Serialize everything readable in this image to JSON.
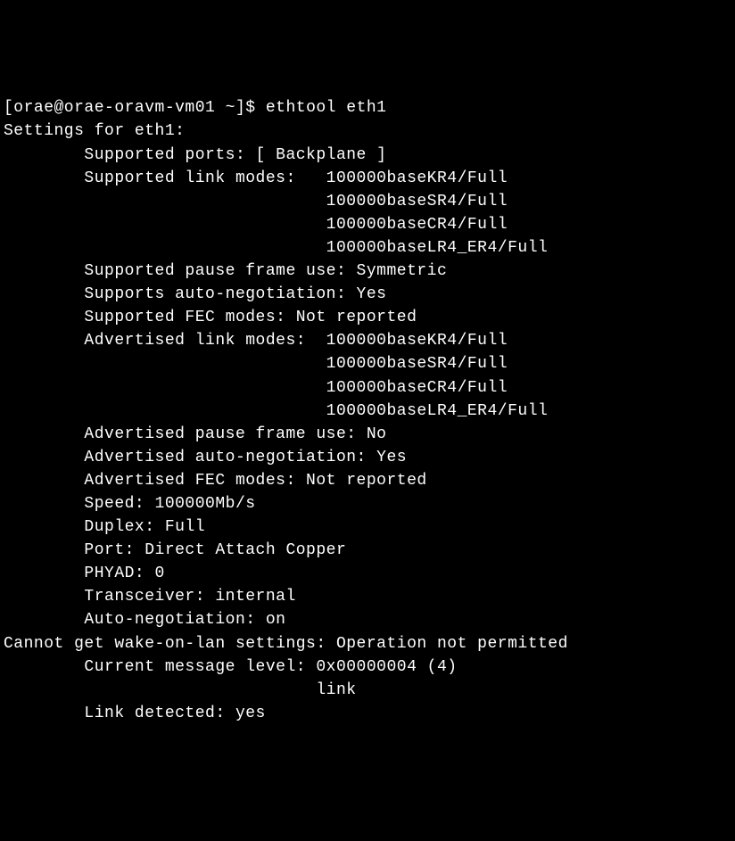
{
  "prompt": "[orae@orae-oravm-vm01 ~]$ ",
  "command": "ethtool eth1",
  "output": {
    "header": "Settings for eth1:",
    "supported_ports_label": "        Supported ports: [ Backplane ]",
    "supported_link_modes_label": "        Supported link modes:   ",
    "supported_link_modes": [
      "100000baseKR4/Full",
      "100000baseSR4/Full",
      "100000baseCR4/Full",
      "100000baseLR4_ER4/Full"
    ],
    "supported_link_modes_indent": "                                ",
    "supported_pause_frame": "        Supported pause frame use: Symmetric",
    "supports_auto_neg": "        Supports auto-negotiation: Yes",
    "supported_fec": "        Supported FEC modes: Not reported",
    "advertised_link_modes_label": "        Advertised link modes:  ",
    "advertised_link_modes": [
      "100000baseKR4/Full",
      "100000baseSR4/Full",
      "100000baseCR4/Full",
      "100000baseLR4_ER4/Full"
    ],
    "advertised_link_modes_indent": "                                ",
    "advertised_pause_frame": "        Advertised pause frame use: No",
    "advertised_auto_neg": "        Advertised auto-negotiation: Yes",
    "advertised_fec": "        Advertised FEC modes: Not reported",
    "speed": "        Speed: 100000Mb/s",
    "duplex": "        Duplex: Full",
    "port": "        Port: Direct Attach Copper",
    "phyad": "        PHYAD: 0",
    "transceiver": "        Transceiver: internal",
    "auto_negotiation": "        Auto-negotiation: on",
    "wol_error": "Cannot get wake-on-lan settings: Operation not permitted",
    "msg_level": "        Current message level: 0x00000004 (4)",
    "msg_level_link": "                               link",
    "link_detected": "        Link detected: yes"
  }
}
